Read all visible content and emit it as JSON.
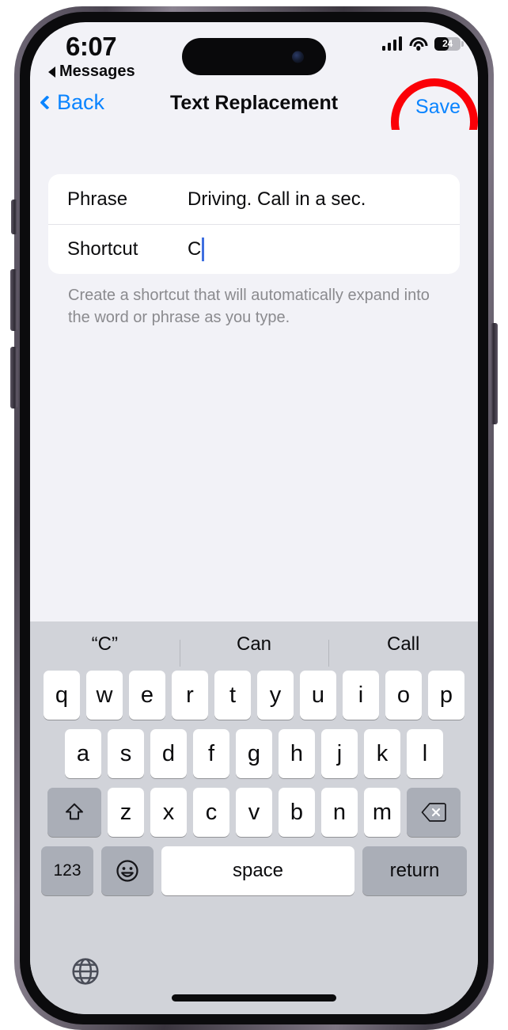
{
  "status_bar": {
    "time": "6:07",
    "back_app_label": "Messages",
    "battery_percent": "24",
    "battery_level_pct": 24,
    "signal_icon": "cellular-signal-icon",
    "wifi_icon": "wifi-icon",
    "battery_icon": "battery-icon"
  },
  "nav_bar": {
    "back_label": "Back",
    "title": "Text Replacement",
    "save_label": "Save",
    "annotation_color": "#fb0007",
    "accent_color": "#0a84ff"
  },
  "form": {
    "rows": [
      {
        "label": "Phrase",
        "value": "Driving. Call in a sec."
      },
      {
        "label": "Shortcut",
        "value": "C"
      }
    ],
    "hint": "Create a shortcut that will automatically expand into the word or phrase as you type."
  },
  "keyboard": {
    "predictions": [
      "“C”",
      "Can",
      "Call"
    ],
    "row1": [
      "q",
      "w",
      "e",
      "r",
      "t",
      "y",
      "u",
      "i",
      "o",
      "p"
    ],
    "row2": [
      "a",
      "s",
      "d",
      "f",
      "g",
      "h",
      "j",
      "k",
      "l"
    ],
    "row3": [
      "z",
      "x",
      "c",
      "v",
      "b",
      "n",
      "m"
    ],
    "shift_icon": "shift-arrow-icon",
    "delete_icon": "delete-backspace-icon",
    "numbers_label": "123",
    "emoji_icon": "emoji-smiley-icon",
    "space_label": "space",
    "return_label": "return",
    "globe_icon": "globe-keyboard-switch-icon"
  }
}
